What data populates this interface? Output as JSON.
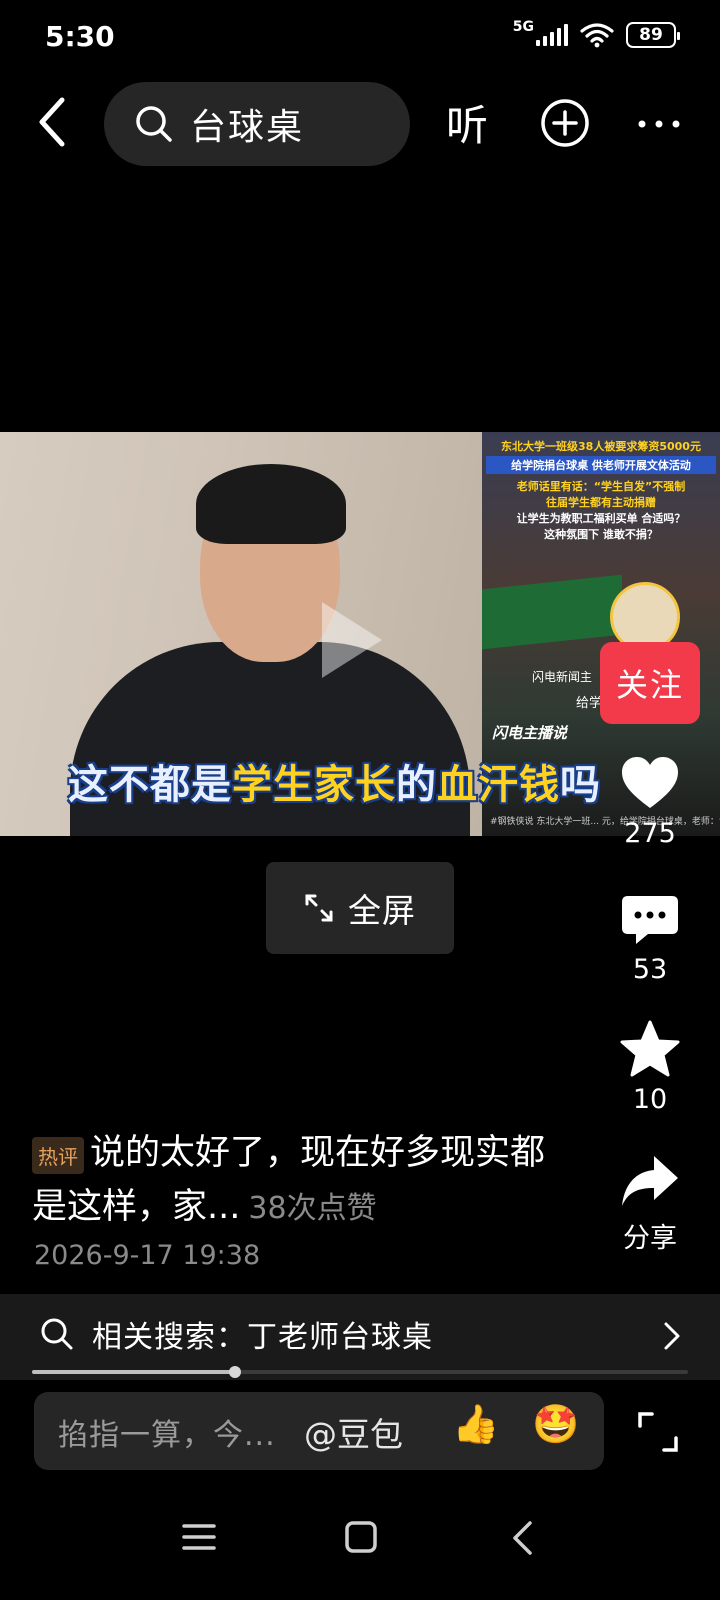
{
  "status_bar": {
    "time": "5:30",
    "network": "5G",
    "battery": "89"
  },
  "top_nav": {
    "search_query": "台球桌",
    "listen_label": "听"
  },
  "video": {
    "caption_part1": "这不都是",
    "caption_part2": "学生家长",
    "caption_part3": "的",
    "caption_part4": "血汗钱",
    "caption_part5": "吗",
    "inset_lines": [
      "东北大学一班级38人被要求筹资5000元",
      "给学院捐台球桌 供老师开展文体活动",
      "老师话里有话：“学生自发”不强制",
      "往届学生都有主动捐赠",
      "让学生为教职工福利买单 合适吗？",
      "这种氛围下 谁敢不捐？"
    ],
    "inset_brand": "闪电新闻主",
    "inset_sub": "给学院捐",
    "inset_brand2": "闪电主播说",
    "inset_footer": "#钢铁侠说 东北大学一班... 元，给学院捐台球桌，老师：“学生自发行... 展开"
  },
  "follow_label": "关注",
  "actions": {
    "like_count": "275",
    "comment_count": "53",
    "favorite_count": "10",
    "share_label": "分享"
  },
  "fullscreen_label": "全屏",
  "hot_comment": {
    "badge": "热评",
    "text": "说的太好了，现在好多现实都是这样，家...",
    "likes": "38次点赞",
    "date": "2026-9-17 19:38"
  },
  "related_search": {
    "text": "相关搜索：丁老师台球桌"
  },
  "progress": {
    "fraction": 0.31
  },
  "input_bar": {
    "placeholder": "掐指一算，今...",
    "mention": "@豆包"
  },
  "colors": {
    "accent_red": "#f23a4b",
    "badge_orange": "#e5a15c",
    "caption_yellow": "#ffd21f"
  }
}
